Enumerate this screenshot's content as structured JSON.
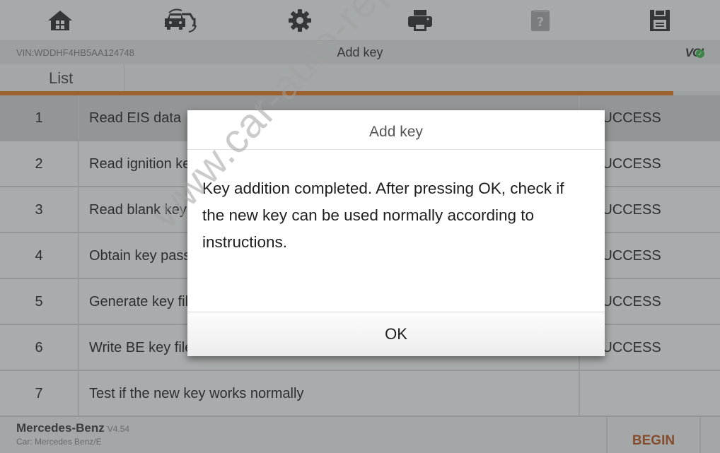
{
  "toolbar": {
    "items": [
      {
        "name": "home",
        "icon": "home-icon",
        "enabled": true
      },
      {
        "name": "change-vehicle",
        "icon": "car-swap-icon",
        "enabled": true
      },
      {
        "name": "settings",
        "icon": "gear-icon",
        "enabled": true
      },
      {
        "name": "print",
        "icon": "printer-icon",
        "enabled": true
      },
      {
        "name": "help",
        "icon": "help-book-icon",
        "enabled": false
      },
      {
        "name": "save",
        "icon": "floppy-disk-icon",
        "enabled": true
      }
    ]
  },
  "infobar": {
    "vin": "VIN:WDDHF4HB5AA124748",
    "title": "Add key",
    "vci_label": "VCI",
    "vci_status": "connected",
    "vci_check": "✓"
  },
  "tabs": [
    {
      "label": "List",
      "active": true
    }
  ],
  "progress": {
    "percent": 93.5,
    "color": "#e2781c"
  },
  "steps": [
    {
      "num": "1",
      "description": "Read EIS data",
      "status": "SUCCESS",
      "selected": true
    },
    {
      "num": "2",
      "description": "Read ignition key",
      "status": "SUCCESS",
      "selected": false
    },
    {
      "num": "3",
      "description": "Read blank key",
      "status": "SUCCESS",
      "selected": false
    },
    {
      "num": "4",
      "description": "Obtain key password",
      "status": "SUCCESS",
      "selected": false
    },
    {
      "num": "5",
      "description": "Generate key file",
      "status": "SUCCESS",
      "selected": false
    },
    {
      "num": "6",
      "description": "Write BE key file",
      "status": "SUCCESS",
      "selected": false
    },
    {
      "num": "7",
      "description": "Test if the new key works normally",
      "status": "",
      "selected": false
    }
  ],
  "footer": {
    "brand": "Mercedes-Benz",
    "version": "V4.54",
    "car": "Car: Mercedes Benz/E",
    "begin_label": "BEGIN"
  },
  "dialog": {
    "title": "Add key",
    "message": "Key addition completed. After pressing OK, check if the new key can be used normally according to instructions.",
    "ok_label": "OK"
  },
  "watermark": "www.car-auto-repair.com"
}
